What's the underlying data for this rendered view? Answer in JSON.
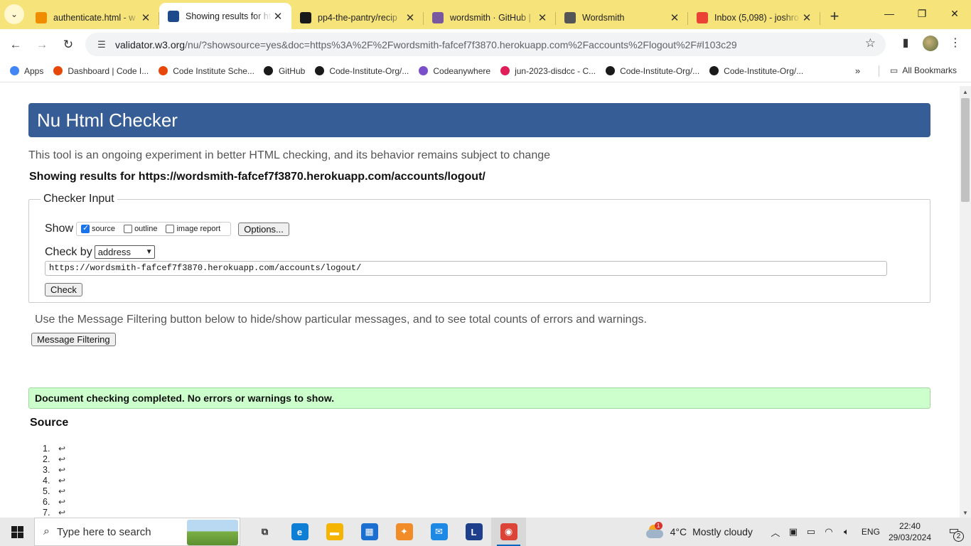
{
  "browser": {
    "tabs": [
      {
        "title": "authenticate.html - w",
        "icon": "gitpod-icon",
        "color": "#f08c00",
        "active": false
      },
      {
        "title": "Showing results for ht",
        "icon": "w3c-validator-icon",
        "color": "#1c4a8a",
        "active": true
      },
      {
        "title": "pp4-the-pantry/recip",
        "icon": "github-icon",
        "color": "#1a1a1a",
        "active": false
      },
      {
        "title": "wordsmith · GitHub |",
        "icon": "heroku-icon",
        "color": "#79589f",
        "active": false
      },
      {
        "title": "Wordsmith",
        "icon": "globe-icon",
        "color": "#555555",
        "active": false
      },
      {
        "title": "Inbox (5,098) - joshro",
        "icon": "gmail-icon",
        "color": "#ea4335",
        "active": false
      }
    ],
    "url_host": "validator.w3.org",
    "url_rest": "/nu/?showsource=yes&doc=https%3A%2F%2Fwordsmith-fafcef7f3870.herokuapp.com%2Faccounts%2Flogout%2F#l103c29",
    "bookmarks": [
      {
        "label": "Apps",
        "icon": "apps-grid-icon",
        "color": "#4285f4"
      },
      {
        "label": "Dashboard | Code I...",
        "icon": "code-institute-icon",
        "color": "#e8470a"
      },
      {
        "label": "Code Institute Sche...",
        "icon": "code-institute-icon",
        "color": "#e8470a"
      },
      {
        "label": "GitHub",
        "icon": "github-icon",
        "color": "#1a1a1a"
      },
      {
        "label": "Code-Institute-Org/...",
        "icon": "github-icon",
        "color": "#1a1a1a"
      },
      {
        "label": "Codeanywhere",
        "icon": "codeanywhere-icon",
        "color": "#7b4fc9"
      },
      {
        "label": "jun-2023-disdcc - C...",
        "icon": "slack-icon",
        "color": "#e01e5a"
      },
      {
        "label": "Code-Institute-Org/...",
        "icon": "github-icon",
        "color": "#1a1a1a"
      },
      {
        "label": "Code-Institute-Org/...",
        "icon": "github-icon",
        "color": "#1a1a1a"
      }
    ],
    "all_bookmarks": "All Bookmarks"
  },
  "page": {
    "title": "Nu Html Checker",
    "tagline": "This tool is an ongoing experiment in better HTML checking, and its behavior remains subject to change",
    "showing": "Showing results for https://wordsmith-fafcef7f3870.herokuapp.com/accounts/logout/",
    "checker_legend": "Checker Input",
    "show_label": "Show",
    "options": [
      {
        "label": "source",
        "checked": true
      },
      {
        "label": "outline",
        "checked": false
      },
      {
        "label": "image report",
        "checked": false
      }
    ],
    "options_button": "Options...",
    "check_by_label": "Check by",
    "check_by_value": "address",
    "url_value": "https://wordsmith-fafcef7f3870.herokuapp.com/accounts/logout/",
    "check_button": "Check",
    "filter_text": "Use the Message Filtering button below to hide/show particular messages, and to see total counts of errors and warnings.",
    "filter_button": "Message Filtering",
    "success_message": "Document checking completed. No errors or warnings to show.",
    "source_heading": "Source",
    "source_lines": [
      "1.",
      "2.",
      "3.",
      "4.",
      "5.",
      "6.",
      "7."
    ],
    "return_glyph": "↩"
  },
  "taskbar": {
    "search_placeholder": "Type here to search",
    "apps": [
      {
        "name": "task-view-icon",
        "glyph": "⧉",
        "color": "#333333"
      },
      {
        "name": "edge-icon",
        "glyph": "e",
        "color": "#0f7fd6"
      },
      {
        "name": "file-explorer-icon",
        "glyph": "▬",
        "color": "#f4b400"
      },
      {
        "name": "microsoft-store-icon",
        "glyph": "▦",
        "color": "#1b6fd1"
      },
      {
        "name": "app-icon",
        "glyph": "✦",
        "color": "#f28c28"
      },
      {
        "name": "mail-icon",
        "glyph": "✉",
        "color": "#1e88e5"
      },
      {
        "name": "l-app-icon",
        "glyph": "L",
        "color": "#1d3f8c"
      },
      {
        "name": "chrome-icon",
        "glyph": "◉",
        "color": "#db4437"
      }
    ],
    "weather_temp": "4°C",
    "weather_desc": "Mostly cloudy",
    "weather_badge": "1",
    "language": "ENG",
    "time": "22:40",
    "date": "29/03/2024",
    "notification_count": "2"
  }
}
